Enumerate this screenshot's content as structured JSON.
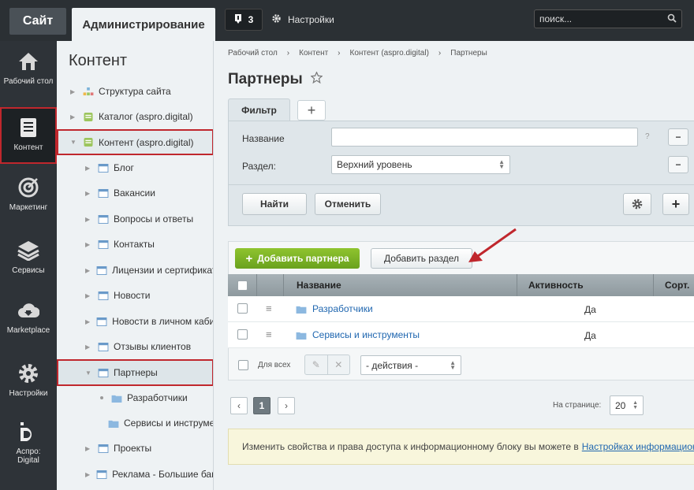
{
  "topbar": {
    "site_tab": "Сайт",
    "admin_tab": "Администрирование",
    "notifications_count": "3",
    "settings_label": "Настройки",
    "search_placeholder": "поиск..."
  },
  "vmenu": {
    "items": [
      {
        "label": "Рабочий стол",
        "icon": "home-icon"
      },
      {
        "label": "Контент",
        "icon": "document-icon"
      },
      {
        "label": "Маркетинг",
        "icon": "target-icon"
      },
      {
        "label": "Сервисы",
        "icon": "layers-icon"
      },
      {
        "label": "Marketplace",
        "icon": "cloud-download-icon"
      },
      {
        "label": "Настройки",
        "icon": "gear-icon"
      },
      {
        "label": "Аспро: Digital",
        "icon": "aspro-logo-icon"
      }
    ]
  },
  "tree": {
    "title": "Контент",
    "items": [
      {
        "label": "Структура сайта"
      },
      {
        "label": "Каталог (aspro.digital)"
      },
      {
        "label": "Контент (aspro.digital)"
      },
      {
        "label": "Блог"
      },
      {
        "label": "Вакансии"
      },
      {
        "label": "Вопросы и ответы"
      },
      {
        "label": "Контакты"
      },
      {
        "label": "Лицензии и сертификаты"
      },
      {
        "label": "Новости"
      },
      {
        "label": "Новости в личном кабинете"
      },
      {
        "label": "Отзывы клиентов"
      },
      {
        "label": "Партнеры"
      },
      {
        "label": "Разработчики"
      },
      {
        "label": "Сервисы и инструменты"
      },
      {
        "label": "Проекты"
      },
      {
        "label": "Реклама - Большие баннеры"
      }
    ]
  },
  "breadcrumb": [
    "Рабочий стол",
    "Контент",
    "Контент (aspro.digital)",
    "Партнеры"
  ],
  "page_title": "Партнеры",
  "filter": {
    "tab_label": "Фильтр",
    "name_label": "Название",
    "section_label": "Раздел:",
    "section_value": "Верхний уровень",
    "help": "?",
    "find_button": "Найти",
    "cancel_button": "Отменить"
  },
  "list": {
    "add_partner": "Добавить партнера",
    "add_section": "Добавить раздел",
    "columns": [
      "Название",
      "Активность",
      "Сорт."
    ],
    "rows": [
      {
        "name": "Разработчики",
        "active": "Да"
      },
      {
        "name": "Сервисы и инструменты",
        "active": "Да"
      }
    ],
    "for_all": "Для всех",
    "actions_placeholder": "- действия -"
  },
  "pagination": {
    "current_page": "1",
    "per_page_label": "На странице:",
    "per_page_value": "20"
  },
  "notice": {
    "text": "Изменить свойства и права доступа к информационному блоку вы можете в",
    "link": "Настройках информационного блока"
  },
  "colors": {
    "accent_green": "#7ab326",
    "highlight_red": "#c0272d",
    "link_blue": "#2067b0"
  }
}
